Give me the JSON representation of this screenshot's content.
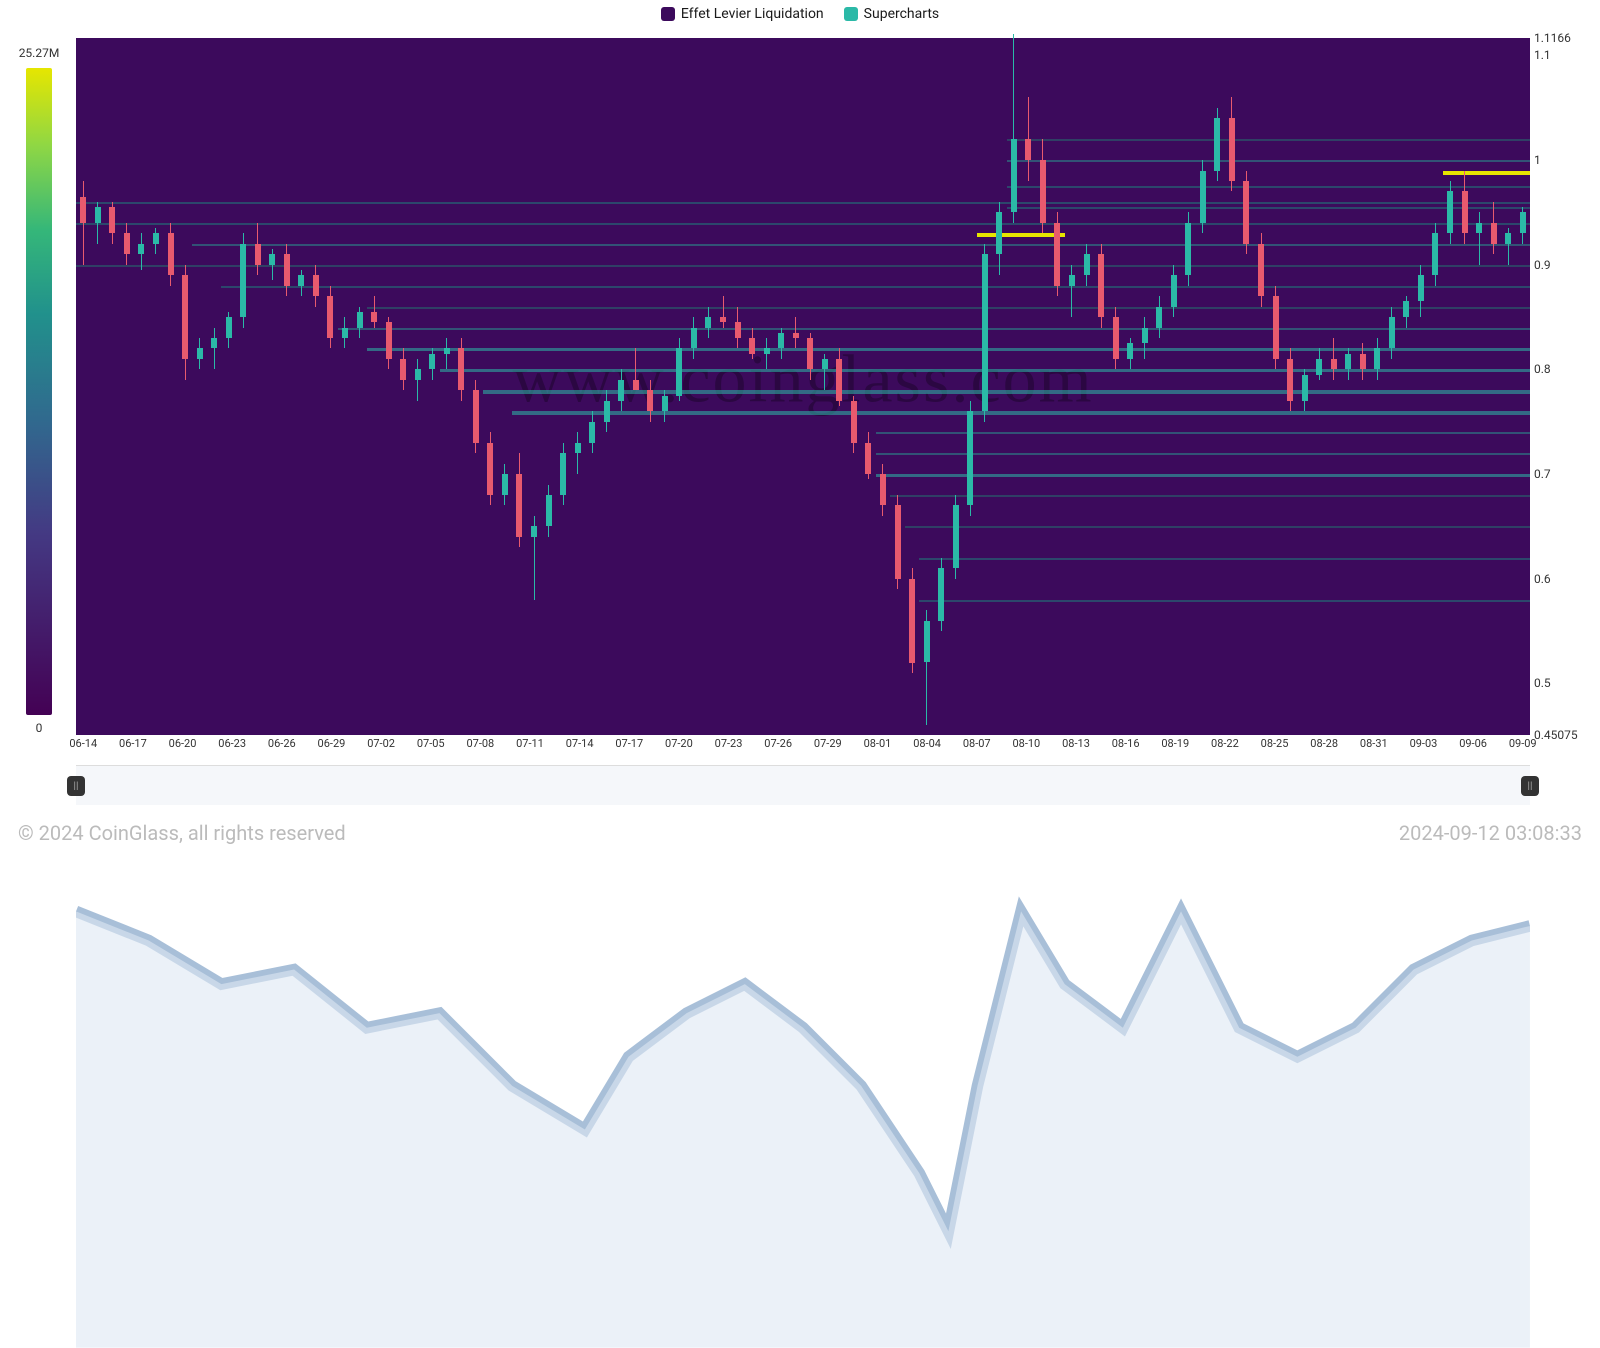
{
  "legend": {
    "series1": {
      "label": "Effet Levier Liquidation",
      "color": "#3c0a5c"
    },
    "series2": {
      "label": "Supercharts",
      "color": "#2bb9a7"
    }
  },
  "colorbar": {
    "max": "25.27M",
    "min": "0"
  },
  "watermark": "www.coinglass.com",
  "copyright": "© 2024 CoinGlass, all rights reserved",
  "timestamp": "2024-09-12 03:08:33",
  "y_axis": {
    "ticks": [
      {
        "v": 1.1166,
        "label": "1.1166"
      },
      {
        "v": 1.1,
        "label": "1.1"
      },
      {
        "v": 1.0,
        "label": "1"
      },
      {
        "v": 0.9,
        "label": "0.9"
      },
      {
        "v": 0.8,
        "label": "0.8"
      },
      {
        "v": 0.7,
        "label": "0.7"
      },
      {
        "v": 0.6,
        "label": "0.6"
      },
      {
        "v": 0.5,
        "label": "0.5"
      },
      {
        "v": 0.45075,
        "label": "0.45075"
      }
    ],
    "min": 0.45075,
    "max": 1.1166
  },
  "x_axis": {
    "ticks": [
      "06-14",
      "06-17",
      "06-20",
      "06-23",
      "06-26",
      "06-29",
      "07-02",
      "07-05",
      "07-08",
      "07-11",
      "07-14",
      "07-17",
      "07-20",
      "07-23",
      "07-26",
      "07-29",
      "08-01",
      "08-04",
      "08-07",
      "08-10",
      "08-13",
      "08-16",
      "08-19",
      "08-22",
      "08-25",
      "08-28",
      "08-31",
      "09-03",
      "09-06",
      "09-09"
    ]
  },
  "chart_data": {
    "type": "candlestick-heatmap",
    "title": "",
    "xlabel": "",
    "ylabel": "",
    "ylim": [
      0.45075,
      1.1166
    ],
    "legend": [
      "Effet Levier Liquidation",
      "Supercharts"
    ],
    "colorbar_range": [
      0,
      25270000
    ],
    "x_ticks": [
      "06-14",
      "06-17",
      "06-20",
      "06-23",
      "06-26",
      "06-29",
      "07-02",
      "07-05",
      "07-08",
      "07-11",
      "07-14",
      "07-17",
      "07-20",
      "07-23",
      "07-26",
      "07-29",
      "08-01",
      "08-04",
      "08-07",
      "08-10",
      "08-13",
      "08-16",
      "08-19",
      "08-22",
      "08-25",
      "08-28",
      "08-31",
      "09-03",
      "09-06",
      "09-09"
    ],
    "candles": [
      {
        "i": 0,
        "o": 0.965,
        "h": 0.98,
        "l": 0.9,
        "c": 0.94,
        "up": false
      },
      {
        "i": 1,
        "o": 0.94,
        "h": 0.96,
        "l": 0.92,
        "c": 0.955,
        "up": true
      },
      {
        "i": 2,
        "o": 0.955,
        "h": 0.96,
        "l": 0.92,
        "c": 0.93,
        "up": false
      },
      {
        "i": 3,
        "o": 0.93,
        "h": 0.94,
        "l": 0.9,
        "c": 0.91,
        "up": false
      },
      {
        "i": 4,
        "o": 0.91,
        "h": 0.93,
        "l": 0.895,
        "c": 0.92,
        "up": true
      },
      {
        "i": 5,
        "o": 0.92,
        "h": 0.935,
        "l": 0.91,
        "c": 0.93,
        "up": true
      },
      {
        "i": 6,
        "o": 0.93,
        "h": 0.94,
        "l": 0.88,
        "c": 0.89,
        "up": false
      },
      {
        "i": 7,
        "o": 0.89,
        "h": 0.9,
        "l": 0.79,
        "c": 0.81,
        "up": false
      },
      {
        "i": 8,
        "o": 0.81,
        "h": 0.83,
        "l": 0.8,
        "c": 0.82,
        "up": true
      },
      {
        "i": 9,
        "o": 0.82,
        "h": 0.84,
        "l": 0.8,
        "c": 0.83,
        "up": true
      },
      {
        "i": 10,
        "o": 0.83,
        "h": 0.855,
        "l": 0.82,
        "c": 0.85,
        "up": true
      },
      {
        "i": 11,
        "o": 0.85,
        "h": 0.93,
        "l": 0.84,
        "c": 0.92,
        "up": true
      },
      {
        "i": 12,
        "o": 0.92,
        "h": 0.94,
        "l": 0.89,
        "c": 0.9,
        "up": false
      },
      {
        "i": 13,
        "o": 0.9,
        "h": 0.915,
        "l": 0.885,
        "c": 0.91,
        "up": true
      },
      {
        "i": 14,
        "o": 0.91,
        "h": 0.92,
        "l": 0.87,
        "c": 0.88,
        "up": false
      },
      {
        "i": 15,
        "o": 0.88,
        "h": 0.895,
        "l": 0.87,
        "c": 0.89,
        "up": true
      },
      {
        "i": 16,
        "o": 0.89,
        "h": 0.9,
        "l": 0.86,
        "c": 0.87,
        "up": false
      },
      {
        "i": 17,
        "o": 0.87,
        "h": 0.88,
        "l": 0.82,
        "c": 0.83,
        "up": false
      },
      {
        "i": 18,
        "o": 0.83,
        "h": 0.85,
        "l": 0.82,
        "c": 0.84,
        "up": true
      },
      {
        "i": 19,
        "o": 0.84,
        "h": 0.86,
        "l": 0.83,
        "c": 0.855,
        "up": true
      },
      {
        "i": 20,
        "o": 0.855,
        "h": 0.87,
        "l": 0.84,
        "c": 0.845,
        "up": false
      },
      {
        "i": 21,
        "o": 0.845,
        "h": 0.85,
        "l": 0.8,
        "c": 0.81,
        "up": false
      },
      {
        "i": 22,
        "o": 0.81,
        "h": 0.82,
        "l": 0.78,
        "c": 0.79,
        "up": false
      },
      {
        "i": 23,
        "o": 0.79,
        "h": 0.81,
        "l": 0.77,
        "c": 0.8,
        "up": true
      },
      {
        "i": 24,
        "o": 0.8,
        "h": 0.82,
        "l": 0.79,
        "c": 0.815,
        "up": true
      },
      {
        "i": 25,
        "o": 0.815,
        "h": 0.83,
        "l": 0.8,
        "c": 0.82,
        "up": true
      },
      {
        "i": 26,
        "o": 0.82,
        "h": 0.83,
        "l": 0.77,
        "c": 0.78,
        "up": false
      },
      {
        "i": 27,
        "o": 0.78,
        "h": 0.79,
        "l": 0.72,
        "c": 0.73,
        "up": false
      },
      {
        "i": 28,
        "o": 0.73,
        "h": 0.74,
        "l": 0.67,
        "c": 0.68,
        "up": false
      },
      {
        "i": 29,
        "o": 0.68,
        "h": 0.71,
        "l": 0.67,
        "c": 0.7,
        "up": true
      },
      {
        "i": 30,
        "o": 0.7,
        "h": 0.72,
        "l": 0.63,
        "c": 0.64,
        "up": false
      },
      {
        "i": 31,
        "o": 0.64,
        "h": 0.66,
        "l": 0.58,
        "c": 0.65,
        "up": true
      },
      {
        "i": 32,
        "o": 0.65,
        "h": 0.69,
        "l": 0.64,
        "c": 0.68,
        "up": true
      },
      {
        "i": 33,
        "o": 0.68,
        "h": 0.73,
        "l": 0.67,
        "c": 0.72,
        "up": true
      },
      {
        "i": 34,
        "o": 0.72,
        "h": 0.74,
        "l": 0.7,
        "c": 0.73,
        "up": true
      },
      {
        "i": 35,
        "o": 0.73,
        "h": 0.76,
        "l": 0.72,
        "c": 0.75,
        "up": true
      },
      {
        "i": 36,
        "o": 0.75,
        "h": 0.78,
        "l": 0.74,
        "c": 0.77,
        "up": true
      },
      {
        "i": 37,
        "o": 0.77,
        "h": 0.8,
        "l": 0.76,
        "c": 0.79,
        "up": true
      },
      {
        "i": 38,
        "o": 0.79,
        "h": 0.82,
        "l": 0.78,
        "c": 0.78,
        "up": false
      },
      {
        "i": 39,
        "o": 0.78,
        "h": 0.79,
        "l": 0.75,
        "c": 0.76,
        "up": false
      },
      {
        "i": 40,
        "o": 0.76,
        "h": 0.78,
        "l": 0.75,
        "c": 0.775,
        "up": true
      },
      {
        "i": 41,
        "o": 0.775,
        "h": 0.83,
        "l": 0.77,
        "c": 0.82,
        "up": true
      },
      {
        "i": 42,
        "o": 0.82,
        "h": 0.85,
        "l": 0.81,
        "c": 0.84,
        "up": true
      },
      {
        "i": 43,
        "o": 0.84,
        "h": 0.86,
        "l": 0.83,
        "c": 0.85,
        "up": true
      },
      {
        "i": 44,
        "o": 0.85,
        "h": 0.87,
        "l": 0.84,
        "c": 0.845,
        "up": false
      },
      {
        "i": 45,
        "o": 0.845,
        "h": 0.86,
        "l": 0.82,
        "c": 0.83,
        "up": false
      },
      {
        "i": 46,
        "o": 0.83,
        "h": 0.84,
        "l": 0.81,
        "c": 0.815,
        "up": false
      },
      {
        "i": 47,
        "o": 0.815,
        "h": 0.83,
        "l": 0.8,
        "c": 0.82,
        "up": true
      },
      {
        "i": 48,
        "o": 0.82,
        "h": 0.84,
        "l": 0.81,
        "c": 0.835,
        "up": true
      },
      {
        "i": 49,
        "o": 0.835,
        "h": 0.85,
        "l": 0.82,
        "c": 0.83,
        "up": false
      },
      {
        "i": 50,
        "o": 0.83,
        "h": 0.835,
        "l": 0.79,
        "c": 0.8,
        "up": false
      },
      {
        "i": 51,
        "o": 0.8,
        "h": 0.815,
        "l": 0.78,
        "c": 0.81,
        "up": true
      },
      {
        "i": 52,
        "o": 0.81,
        "h": 0.82,
        "l": 0.765,
        "c": 0.77,
        "up": false
      },
      {
        "i": 53,
        "o": 0.77,
        "h": 0.775,
        "l": 0.72,
        "c": 0.73,
        "up": false
      },
      {
        "i": 54,
        "o": 0.73,
        "h": 0.74,
        "l": 0.695,
        "c": 0.7,
        "up": false
      },
      {
        "i": 55,
        "o": 0.7,
        "h": 0.71,
        "l": 0.66,
        "c": 0.67,
        "up": false
      },
      {
        "i": 56,
        "o": 0.67,
        "h": 0.68,
        "l": 0.59,
        "c": 0.6,
        "up": false
      },
      {
        "i": 57,
        "o": 0.6,
        "h": 0.61,
        "l": 0.51,
        "c": 0.52,
        "up": false
      },
      {
        "i": 58,
        "o": 0.52,
        "h": 0.57,
        "l": 0.46,
        "c": 0.56,
        "up": true
      },
      {
        "i": 59,
        "o": 0.56,
        "h": 0.62,
        "l": 0.55,
        "c": 0.61,
        "up": true
      },
      {
        "i": 60,
        "o": 0.61,
        "h": 0.68,
        "l": 0.6,
        "c": 0.67,
        "up": true
      },
      {
        "i": 61,
        "o": 0.67,
        "h": 0.77,
        "l": 0.66,
        "c": 0.76,
        "up": true
      },
      {
        "i": 62,
        "o": 0.76,
        "h": 0.92,
        "l": 0.75,
        "c": 0.91,
        "up": true
      },
      {
        "i": 63,
        "o": 0.91,
        "h": 0.96,
        "l": 0.89,
        "c": 0.95,
        "up": true
      },
      {
        "i": 64,
        "o": 0.95,
        "h": 1.12,
        "l": 0.94,
        "c": 1.02,
        "up": true
      },
      {
        "i": 65,
        "o": 1.02,
        "h": 1.06,
        "l": 0.98,
        "c": 1.0,
        "up": false
      },
      {
        "i": 66,
        "o": 1.0,
        "h": 1.02,
        "l": 0.93,
        "c": 0.94,
        "up": false
      },
      {
        "i": 67,
        "o": 0.94,
        "h": 0.95,
        "l": 0.87,
        "c": 0.88,
        "up": false
      },
      {
        "i": 68,
        "o": 0.88,
        "h": 0.9,
        "l": 0.85,
        "c": 0.89,
        "up": true
      },
      {
        "i": 69,
        "o": 0.89,
        "h": 0.92,
        "l": 0.88,
        "c": 0.91,
        "up": true
      },
      {
        "i": 70,
        "o": 0.91,
        "h": 0.92,
        "l": 0.84,
        "c": 0.85,
        "up": false
      },
      {
        "i": 71,
        "o": 0.85,
        "h": 0.86,
        "l": 0.8,
        "c": 0.81,
        "up": false
      },
      {
        "i": 72,
        "o": 0.81,
        "h": 0.83,
        "l": 0.8,
        "c": 0.825,
        "up": true
      },
      {
        "i": 73,
        "o": 0.825,
        "h": 0.85,
        "l": 0.81,
        "c": 0.84,
        "up": true
      },
      {
        "i": 74,
        "o": 0.84,
        "h": 0.87,
        "l": 0.83,
        "c": 0.86,
        "up": true
      },
      {
        "i": 75,
        "o": 0.86,
        "h": 0.9,
        "l": 0.85,
        "c": 0.89,
        "up": true
      },
      {
        "i": 76,
        "o": 0.89,
        "h": 0.95,
        "l": 0.88,
        "c": 0.94,
        "up": true
      },
      {
        "i": 77,
        "o": 0.94,
        "h": 1.0,
        "l": 0.93,
        "c": 0.99,
        "up": true
      },
      {
        "i": 78,
        "o": 0.99,
        "h": 1.05,
        "l": 0.98,
        "c": 1.04,
        "up": true
      },
      {
        "i": 79,
        "o": 1.04,
        "h": 1.06,
        "l": 0.97,
        "c": 0.98,
        "up": false
      },
      {
        "i": 80,
        "o": 0.98,
        "h": 0.99,
        "l": 0.91,
        "c": 0.92,
        "up": false
      },
      {
        "i": 81,
        "o": 0.92,
        "h": 0.93,
        "l": 0.86,
        "c": 0.87,
        "up": false
      },
      {
        "i": 82,
        "o": 0.87,
        "h": 0.88,
        "l": 0.8,
        "c": 0.81,
        "up": false
      },
      {
        "i": 83,
        "o": 0.81,
        "h": 0.82,
        "l": 0.76,
        "c": 0.77,
        "up": false
      },
      {
        "i": 84,
        "o": 0.77,
        "h": 0.8,
        "l": 0.76,
        "c": 0.795,
        "up": true
      },
      {
        "i": 85,
        "o": 0.795,
        "h": 0.82,
        "l": 0.79,
        "c": 0.81,
        "up": true
      },
      {
        "i": 86,
        "o": 0.81,
        "h": 0.83,
        "l": 0.79,
        "c": 0.8,
        "up": false
      },
      {
        "i": 87,
        "o": 0.8,
        "h": 0.82,
        "l": 0.79,
        "c": 0.815,
        "up": true
      },
      {
        "i": 88,
        "o": 0.815,
        "h": 0.825,
        "l": 0.79,
        "c": 0.8,
        "up": false
      },
      {
        "i": 89,
        "o": 0.8,
        "h": 0.83,
        "l": 0.79,
        "c": 0.82,
        "up": true
      },
      {
        "i": 90,
        "o": 0.82,
        "h": 0.86,
        "l": 0.81,
        "c": 0.85,
        "up": true
      },
      {
        "i": 91,
        "o": 0.85,
        "h": 0.87,
        "l": 0.84,
        "c": 0.865,
        "up": true
      },
      {
        "i": 92,
        "o": 0.865,
        "h": 0.9,
        "l": 0.85,
        "c": 0.89,
        "up": true
      },
      {
        "i": 93,
        "o": 0.89,
        "h": 0.94,
        "l": 0.88,
        "c": 0.93,
        "up": true
      },
      {
        "i": 94,
        "o": 0.93,
        "h": 0.98,
        "l": 0.92,
        "c": 0.97,
        "up": true
      },
      {
        "i": 95,
        "o": 0.97,
        "h": 0.99,
        "l": 0.92,
        "c": 0.93,
        "up": false
      },
      {
        "i": 96,
        "o": 0.93,
        "h": 0.95,
        "l": 0.9,
        "c": 0.94,
        "up": true
      },
      {
        "i": 97,
        "o": 0.94,
        "h": 0.96,
        "l": 0.91,
        "c": 0.92,
        "up": false
      },
      {
        "i": 98,
        "o": 0.92,
        "h": 0.935,
        "l": 0.9,
        "c": 0.93,
        "up": true
      },
      {
        "i": 99,
        "o": 0.93,
        "h": 0.955,
        "l": 0.92,
        "c": 0.95,
        "up": true
      }
    ],
    "heatmap_bands": [
      {
        "y": 0.99,
        "from": 94,
        "to": 100,
        "color": "#e6e600",
        "h": 4
      },
      {
        "y": 0.93,
        "from": 62,
        "to": 68,
        "color": "#e6e600",
        "h": 4
      },
      {
        "y": 0.96,
        "from": 0,
        "to": 100,
        "color": "#1f7a7a",
        "h": 2
      },
      {
        "y": 0.94,
        "from": 0,
        "to": 100,
        "color": "#1f7a7a",
        "h": 2
      },
      {
        "y": 0.92,
        "from": 8,
        "to": 100,
        "color": "#29908c",
        "h": 2
      },
      {
        "y": 0.9,
        "from": 0,
        "to": 100,
        "color": "#256d6d",
        "h": 2
      },
      {
        "y": 0.88,
        "from": 10,
        "to": 100,
        "color": "#1f7a7a",
        "h": 2
      },
      {
        "y": 0.86,
        "from": 20,
        "to": 100,
        "color": "#256d6d",
        "h": 2
      },
      {
        "y": 0.84,
        "from": 18,
        "to": 100,
        "color": "#29908c",
        "h": 2
      },
      {
        "y": 0.82,
        "from": 20,
        "to": 100,
        "color": "#2bb9a7",
        "h": 3
      },
      {
        "y": 0.8,
        "from": 25,
        "to": 100,
        "color": "#2bb9a7",
        "h": 3
      },
      {
        "y": 0.78,
        "from": 28,
        "to": 100,
        "color": "#2bb9a7",
        "h": 4
      },
      {
        "y": 0.76,
        "from": 30,
        "to": 100,
        "color": "#2bb9a7",
        "h": 4
      },
      {
        "y": 0.74,
        "from": 55,
        "to": 100,
        "color": "#29908c",
        "h": 2
      },
      {
        "y": 0.72,
        "from": 55,
        "to": 100,
        "color": "#29908c",
        "h": 2
      },
      {
        "y": 0.7,
        "from": 55,
        "to": 100,
        "color": "#2bb9a7",
        "h": 3
      },
      {
        "y": 0.68,
        "from": 56,
        "to": 100,
        "color": "#256d6d",
        "h": 2
      },
      {
        "y": 0.65,
        "from": 57,
        "to": 100,
        "color": "#256d6d",
        "h": 2
      },
      {
        "y": 0.62,
        "from": 58,
        "to": 100,
        "color": "#1f7a7a",
        "h": 2
      },
      {
        "y": 0.58,
        "from": 58,
        "to": 100,
        "color": "#1f7a7a",
        "h": 2
      },
      {
        "y": 1.02,
        "from": 64,
        "to": 100,
        "color": "#256d6d",
        "h": 2
      },
      {
        "y": 1.0,
        "from": 64,
        "to": 100,
        "color": "#29908c",
        "h": 2
      },
      {
        "y": 0.975,
        "from": 64,
        "to": 100,
        "color": "#1f7a7a",
        "h": 2
      },
      {
        "y": 0.955,
        "from": 64,
        "to": 100,
        "color": "#1f7a7a",
        "h": 2
      }
    ]
  }
}
